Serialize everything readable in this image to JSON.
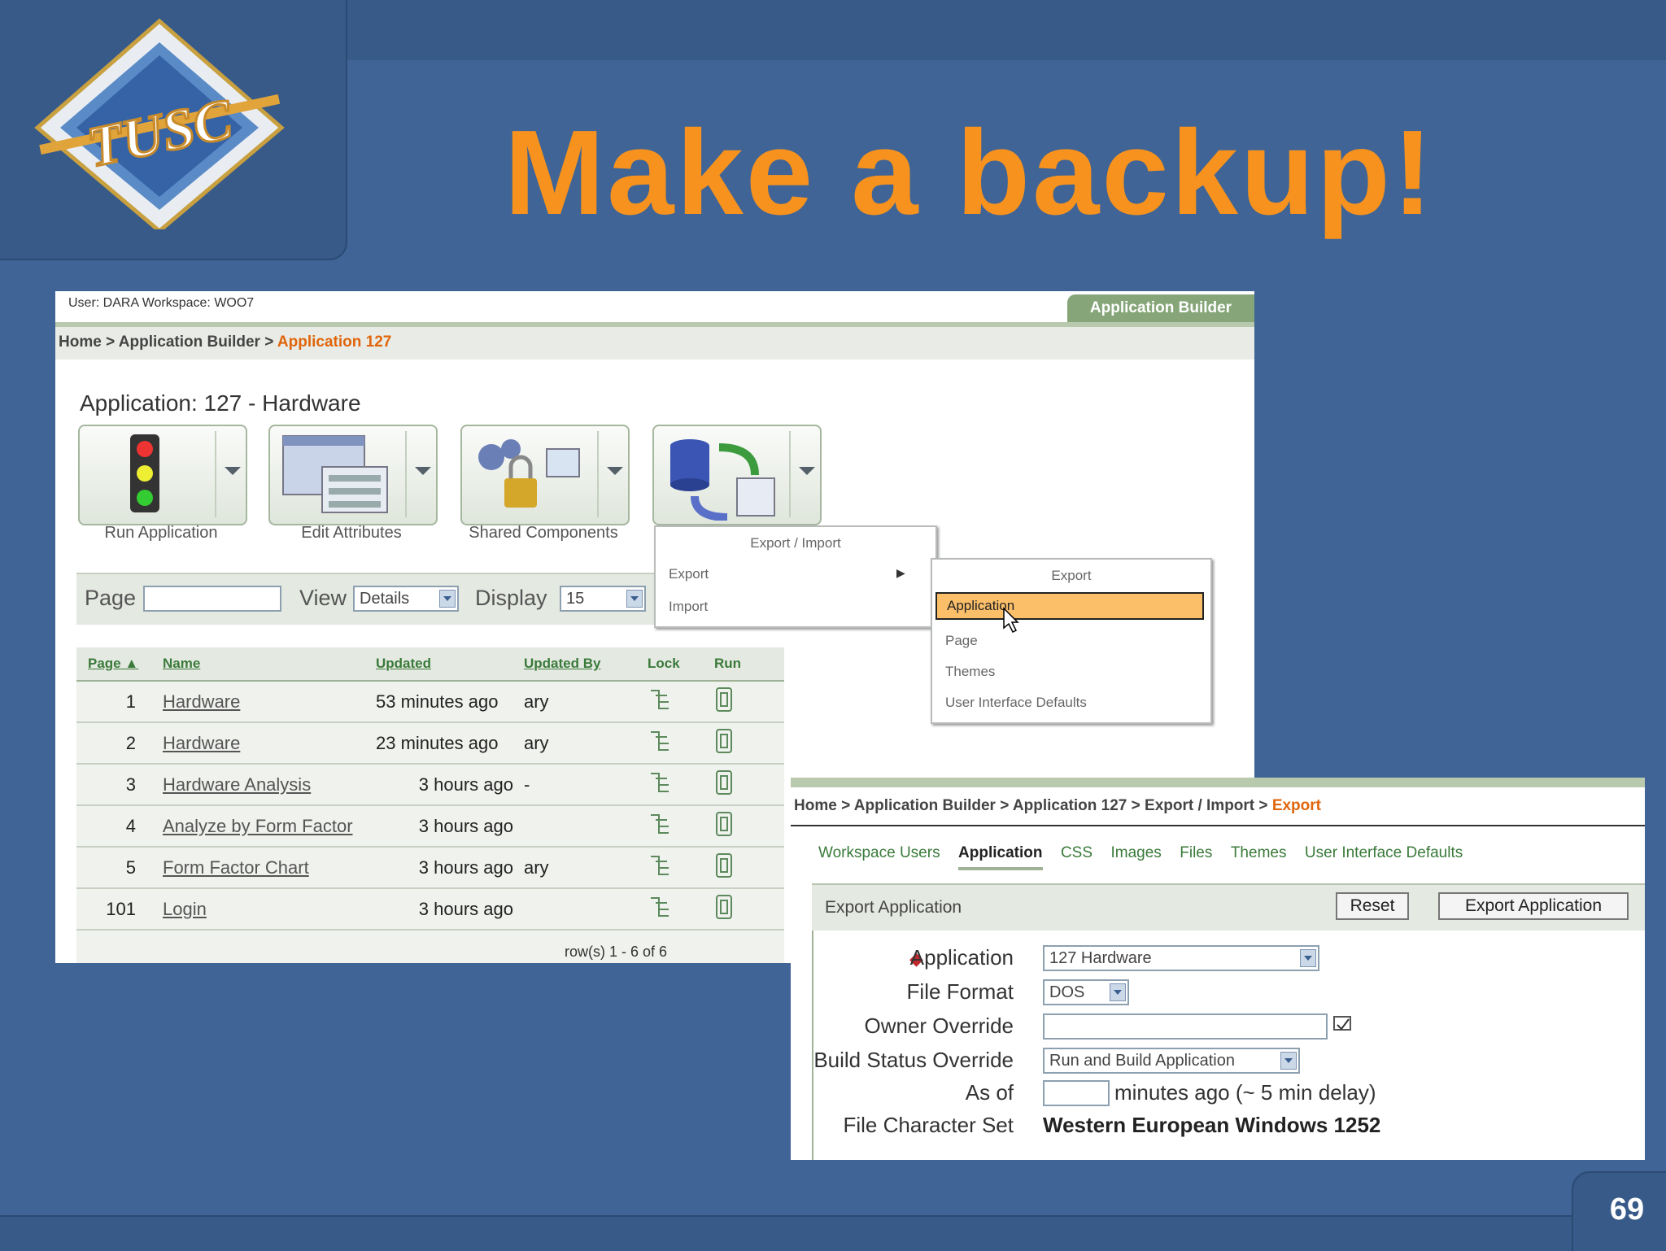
{
  "slide": {
    "title": "Make a backup!",
    "page_number": "69",
    "logo_text": "TUSC"
  },
  "app_builder": {
    "user_bar": "User: DARA  Workspace: WOO7",
    "top_tab": "Application Builder",
    "breadcrumb": {
      "home": "Home",
      "sep": ">",
      "app_builder": "Application Builder",
      "current": "Application 127"
    },
    "heading": "Application: 127 - Hardware",
    "tiles": [
      {
        "label": "Run Application",
        "icon": "traffic-light-icon"
      },
      {
        "label": "Edit Attributes",
        "icon": "edit-attributes-icon"
      },
      {
        "label": "Shared Components",
        "icon": "shared-components-icon"
      },
      {
        "label": "",
        "icon": "export-import-icon"
      }
    ],
    "search_bar": {
      "page_label": "Page",
      "page_value": "",
      "view_label": "View",
      "view_value": "Details",
      "display_label": "Display",
      "display_value": "15"
    },
    "table": {
      "columns": [
        "Page",
        "Name",
        "Updated",
        "Updated By",
        "Lock",
        "Run"
      ],
      "rows": [
        {
          "page": "1",
          "name": "Hardware",
          "updated": "53 minutes ago",
          "by": "ary"
        },
        {
          "page": "2",
          "name": "Hardware",
          "updated": "23 minutes ago",
          "by": "ary"
        },
        {
          "page": "3",
          "name": "Hardware Analysis",
          "updated": "3 hours ago",
          "by": "-"
        },
        {
          "page": "4",
          "name": "Analyze by Form Factor",
          "updated": "3 hours ago",
          "by": ""
        },
        {
          "page": "5",
          "name": "Form Factor Chart",
          "updated": "3 hours ago",
          "by": "ary"
        },
        {
          "page": "101",
          "name": "Login",
          "updated": "3 hours ago",
          "by": ""
        }
      ],
      "footer": "row(s) 1 - 6 of 6"
    },
    "menu1": {
      "title": "Export / Import",
      "items": [
        "Export",
        "Import"
      ]
    },
    "menu2": {
      "title": "Export",
      "items": [
        "Application",
        "Page",
        "Themes",
        "User Interface Defaults"
      ],
      "highlighted": "Application"
    }
  },
  "export_page": {
    "breadcrumb": {
      "home": "Home",
      "app_builder": "Application Builder",
      "app": "Application 127",
      "export_import": "Export / Import",
      "current": "Export",
      "sep": ">"
    },
    "tabs": [
      "Workspace Users",
      "Application",
      "CSS",
      "Images",
      "Files",
      "Themes",
      "User Interface Defaults"
    ],
    "active_tab": "Application",
    "region_title": "Export Application",
    "reset_button": "Reset",
    "export_button": "Export Application",
    "fields": {
      "application_label": "Application",
      "application_value": "127 Hardware",
      "file_format_label": "File Format",
      "file_format_value": "DOS",
      "owner_override_label": "Owner Override",
      "owner_override_value": "",
      "build_status_label": "Build Status Override",
      "build_status_value": "Run and Build Application",
      "as_of_label": "As of",
      "as_of_value": "",
      "as_of_suffix": "minutes ago (~ 5 min delay)",
      "charset_label": "File Character Set",
      "charset_value": "Western European Windows 1252"
    }
  },
  "colors": {
    "title_orange": "#f7921e",
    "slide_blue": "#3f6495",
    "link_green": "#3a7a3a",
    "menu_highlight": "#fbbf6a"
  }
}
